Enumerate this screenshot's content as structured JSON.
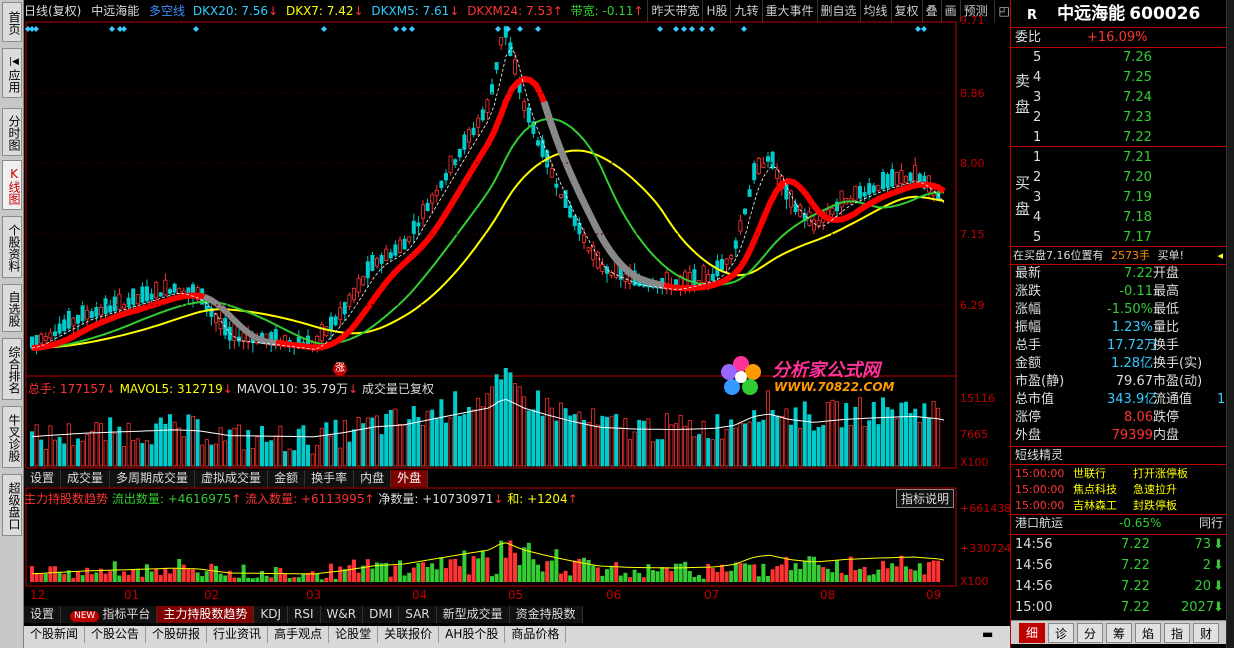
{
  "nav": {
    "items": [
      "首页",
      "应用",
      "分时图",
      "K线图",
      "个股资料",
      "自选股",
      "综合排名",
      "牛叉诊股",
      "超级盘口"
    ]
  },
  "toolbar": {
    "period": "日线(复权)",
    "stock": "中远海能",
    "indicator": "多空线",
    "dkx20": "DKX20: 7.56",
    "dkx7": "DKX7: 7.42",
    "dkxm5": "DKXM5: 7.61",
    "dkxm24": "DKXM24: 7.53",
    "bandwidth": "带宽: -0.11",
    "buttons": [
      "昨天带宽",
      "H股",
      "九转",
      "重大事件",
      "删自选",
      "均线",
      "复权",
      "叠",
      "画",
      "预测"
    ]
  },
  "price_axis": [
    "9.71",
    "8.86",
    "8.00",
    "7.15",
    "6.29"
  ],
  "chart_marks": {
    "limit_up_badge": "涨"
  },
  "volume": {
    "total": "总手: 177157",
    "mavol5": "MAVOL5: 312719",
    "mavol10": "MAVOL10: 35.79万",
    "note": "成交量已复权",
    "axis": [
      "15116",
      "7665",
      "X100"
    ]
  },
  "vol_tabs": [
    "设置",
    "成交量",
    "多周期成交量",
    "虚拟成交量",
    "金额",
    "换手率",
    "内盘",
    "外盘"
  ],
  "main_force": {
    "title": "主力持股数趋势",
    "outflow": "流出数量: +4616975",
    "inflow": "流入数量: +6113995",
    "net": "净数量: +10730971",
    "sum": "和: +1204",
    "help": "指标说明",
    "axis": [
      "+661438",
      "+330724",
      "X100"
    ]
  },
  "x_axis": [
    "12",
    "01",
    "02",
    "03",
    "04",
    "05",
    "06",
    "07",
    "08",
    "09"
  ],
  "ind_tabs": {
    "settings": "设置",
    "new_badge": "NEW",
    "items": [
      "指标平台",
      "主力持股数趋势",
      "KDJ",
      "RSI",
      "W&R",
      "DMI",
      "SAR",
      "新型成交量",
      "资金持股数"
    ]
  },
  "news_tabs": [
    "个股新闻",
    "个股公告",
    "个股研报",
    "行业资讯",
    "高手观点",
    "论股堂",
    "关联报价",
    "AH股个股",
    "商品价格"
  ],
  "watermark": {
    "text": "分析家公式网",
    "url": "WWW.70822.COM"
  },
  "quote": {
    "code_badge": "R",
    "name": "中远海能",
    "code": "600026",
    "weibi_label": "委比",
    "weibi": "+16.09%",
    "sell_label": "卖盘",
    "buy_label": "买盘",
    "sell": [
      {
        "lvl": "5",
        "price": "7.26"
      },
      {
        "lvl": "4",
        "price": "7.25"
      },
      {
        "lvl": "3",
        "price": "7.24"
      },
      {
        "lvl": "2",
        "price": "7.23"
      },
      {
        "lvl": "1",
        "price": "7.22"
      }
    ],
    "buy": [
      {
        "lvl": "1",
        "price": "7.21"
      },
      {
        "lvl": "2",
        "price": "7.20"
      },
      {
        "lvl": "3",
        "price": "7.19"
      },
      {
        "lvl": "4",
        "price": "7.18"
      },
      {
        "lvl": "5",
        "price": "7.17"
      }
    ],
    "bid_note": "在买盘7.16位置有",
    "bid_qty": "2573手",
    "bid_action": "买单!",
    "stats": [
      {
        "k1": "最新",
        "v1": "7.22",
        "c1": "g",
        "k2": "开盘"
      },
      {
        "k1": "涨跌",
        "v1": "-0.11",
        "c1": "g",
        "k2": "最高"
      },
      {
        "k1": "涨幅",
        "v1": "-1.50%",
        "c1": "g",
        "k2": "最低"
      },
      {
        "k1": "振幅",
        "v1": "1.23%",
        "c1": "c",
        "k2": "量比"
      },
      {
        "k1": "总手",
        "v1": "17.72万",
        "c1": "c",
        "k2": "换手"
      },
      {
        "k1": "金额",
        "v1": "1.28亿",
        "c1": "c",
        "k2": "换手(实)"
      },
      {
        "k1": "市盈(静)",
        "v1": "79.67",
        "c1": "w",
        "k2": "市盈(动)"
      },
      {
        "k1": "总市值",
        "v1": "343.9亿",
        "c1": "c",
        "k2": "流通值",
        "v2": "1"
      },
      {
        "k1": "涨停",
        "v1": "8.06",
        "c1": "r",
        "k2": "跌停"
      },
      {
        "k1": "外盘",
        "v1": "79399",
        "c1": "r",
        "k2": "内盘"
      }
    ],
    "elf_title": "短线精灵",
    "elf": [
      {
        "time": "15:00:00",
        "name": "世联行",
        "event": "打开涨停板"
      },
      {
        "time": "15:00:00",
        "name": "焦点科技",
        "event": "急速拉升"
      },
      {
        "time": "15:00:00",
        "name": "吉林森工",
        "event": "封跌停板"
      }
    ],
    "sector_name": "港口航运",
    "sector_change": "-0.65%",
    "sector_btn": "同行",
    "ticks": [
      {
        "time": "14:56",
        "price": "7.22",
        "vol": "73",
        "dir": "down"
      },
      {
        "time": "14:56",
        "price": "7.22",
        "vol": "2",
        "dir": "down"
      },
      {
        "time": "14:56",
        "price": "7.22",
        "vol": "20",
        "dir": "down"
      },
      {
        "time": "15:00",
        "price": "7.22",
        "vol": "2027",
        "dir": "down"
      }
    ],
    "bottom_tabs": [
      "细",
      "诊",
      "分",
      "筹",
      "焰",
      "指",
      "财"
    ]
  },
  "colors": {
    "up": "#ff3333",
    "down": "#00cccc",
    "red_axis": "#c00000",
    "ma_yellow": "#ffff00",
    "ma_green": "#33cc33",
    "dkx_red": "#ff0000",
    "dkx_gray": "#888888"
  }
}
